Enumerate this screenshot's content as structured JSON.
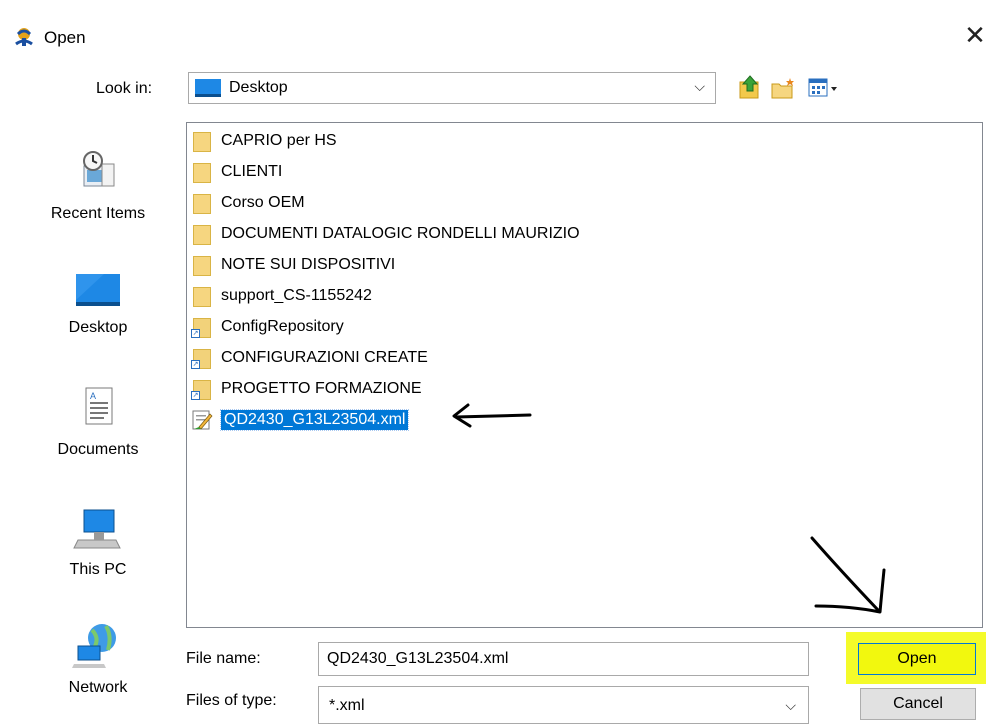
{
  "dialog": {
    "title": "Open",
    "close_symbol": "✕"
  },
  "lookin": {
    "label": "Look in:",
    "value": "Desktop",
    "chevron": "⌵"
  },
  "toolbar": {
    "icons": [
      "up-folder-icon",
      "new-folder-icon",
      "view-menu-icon"
    ]
  },
  "places": [
    {
      "label": "Recent Items",
      "icon": "recent-items-icon"
    },
    {
      "label": "Desktop",
      "icon": "desktop-icon"
    },
    {
      "label": "Documents",
      "icon": "documents-icon"
    },
    {
      "label": "This PC",
      "icon": "this-pc-icon"
    },
    {
      "label": "Network",
      "icon": "network-icon"
    }
  ],
  "files": [
    {
      "name": "CAPRIO per HS",
      "kind": "folder"
    },
    {
      "name": "CLIENTI",
      "kind": "folder"
    },
    {
      "name": "Corso OEM",
      "kind": "folder"
    },
    {
      "name": "DOCUMENTI DATALOGIC RONDELLI MAURIZIO",
      "kind": "folder"
    },
    {
      "name": "NOTE SUI DISPOSITIVI",
      "kind": "folder"
    },
    {
      "name": "support_CS-1155242",
      "kind": "folder"
    },
    {
      "name": "ConfigRepository",
      "kind": "shortcut-folder"
    },
    {
      "name": "CONFIGURAZIONI CREATE",
      "kind": "shortcut-folder"
    },
    {
      "name": "PROGETTO FORMAZIONE",
      "kind": "shortcut-folder"
    },
    {
      "name": "QD2430_G13L23504.xml",
      "kind": "xml-file",
      "selected": true
    }
  ],
  "filename": {
    "label": "File name:",
    "value": "QD2430_G13L23504.xml"
  },
  "filetype": {
    "label": "Files of type:",
    "value": "*.xml",
    "chevron": "⌵"
  },
  "buttons": {
    "open": "Open",
    "cancel": "Cancel"
  },
  "colors": {
    "selection": "#0078d7",
    "open_highlight": "#f4fb2a",
    "folder": "#f6d680"
  }
}
